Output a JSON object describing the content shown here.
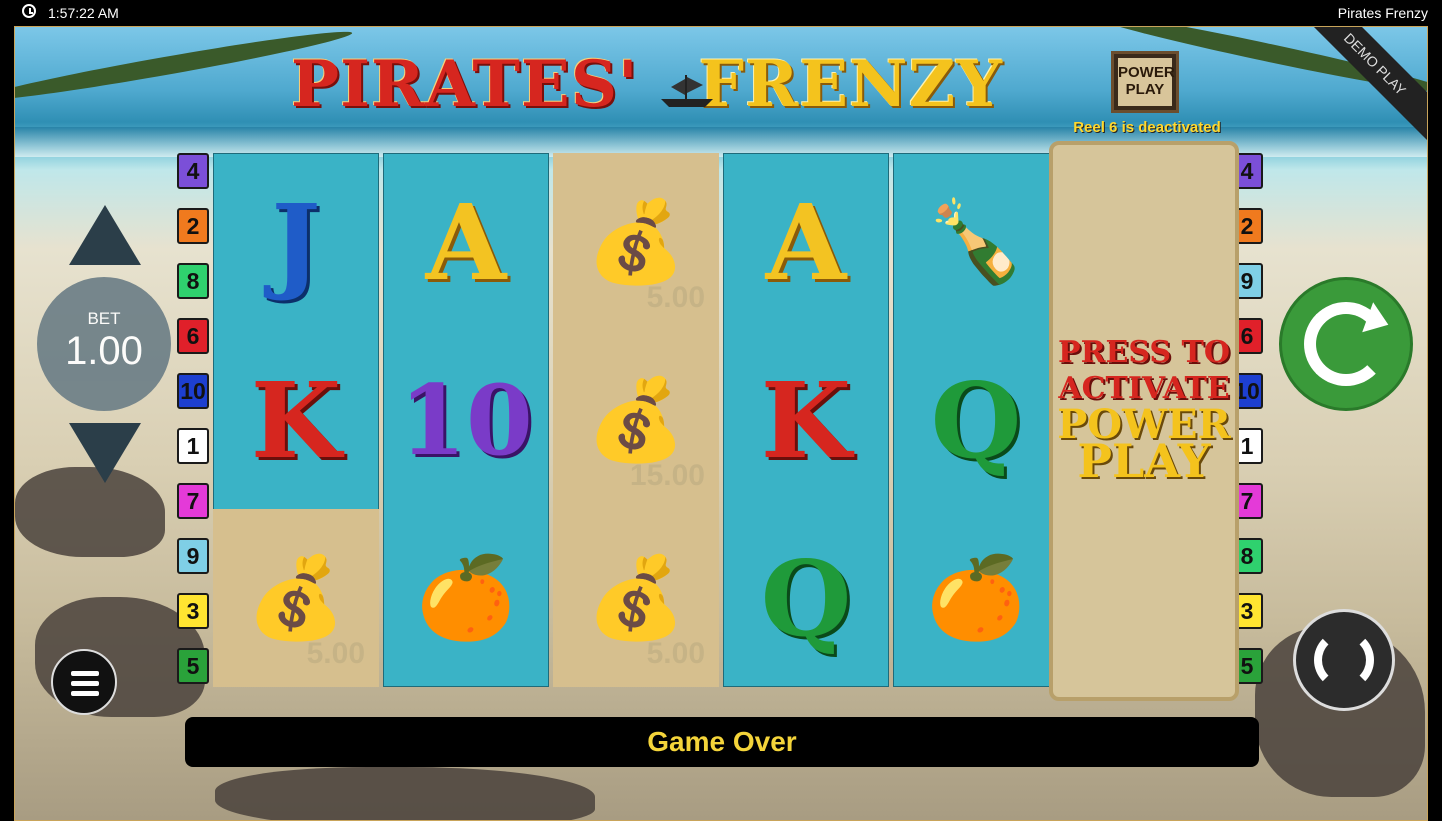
{
  "topbar": {
    "time": "1:57:22 AM",
    "app_title": "Pirates Frenzy"
  },
  "logo": {
    "word1": "PIRATES'",
    "word2": "FRENZY"
  },
  "power_play_badge": {
    "line1": "POWER",
    "line2": "PLAY"
  },
  "reel6_note": "Reel 6 is deactivated",
  "demo_label": "DEMO PLAY",
  "bet": {
    "label": "BET",
    "value": "1.00"
  },
  "paylines_left": [
    "4",
    "2",
    "8",
    "6",
    "10",
    "1",
    "7",
    "9",
    "3",
    "5"
  ],
  "paylines_right": [
    "4",
    "2",
    "9",
    "6",
    "10",
    "1",
    "7",
    "8",
    "3",
    "5"
  ],
  "payline_colors": {
    "4": "#7b4fd8",
    "2": "#f07a1e",
    "8": "#2fd16e",
    "6": "#e0202a",
    "10": "#1d3fd0",
    "1": "#ffffff",
    "7": "#e43ad8",
    "9": "#7fcfe6",
    "3": "#ffe531",
    "5": "#2aa23a"
  },
  "reels": [
    {
      "cells": [
        {
          "sym": "J",
          "bg": "blue"
        },
        {
          "sym": "K",
          "bg": "blue"
        },
        {
          "sym": "bag",
          "bg": "sand",
          "value": "5.00"
        }
      ]
    },
    {
      "cells": [
        {
          "sym": "A",
          "bg": "blue"
        },
        {
          "sym": "10",
          "bg": "blue"
        },
        {
          "sym": "orange",
          "bg": "blue"
        }
      ]
    },
    {
      "cells": [
        {
          "sym": "bag",
          "bg": "sand",
          "value": "5.00"
        },
        {
          "sym": "bag",
          "bg": "sand",
          "value": "15.00"
        },
        {
          "sym": "bag",
          "bg": "sand",
          "value": "5.00"
        }
      ]
    },
    {
      "cells": [
        {
          "sym": "A",
          "bg": "blue"
        },
        {
          "sym": "K",
          "bg": "blue"
        },
        {
          "sym": "Q",
          "bg": "blue"
        }
      ]
    },
    {
      "cells": [
        {
          "sym": "bottle",
          "bg": "blue"
        },
        {
          "sym": "Q",
          "bg": "blue"
        },
        {
          "sym": "orange",
          "bg": "blue"
        }
      ]
    }
  ],
  "reel6_overlay": {
    "line1": "PRESS TO",
    "line2": "ACTIVATE",
    "line3": "POWER",
    "line4": "PLAY"
  },
  "message": "Game Over",
  "symbols_unicode": {
    "bag": "💰",
    "orange": "🍊",
    "bottle": "🍾"
  }
}
